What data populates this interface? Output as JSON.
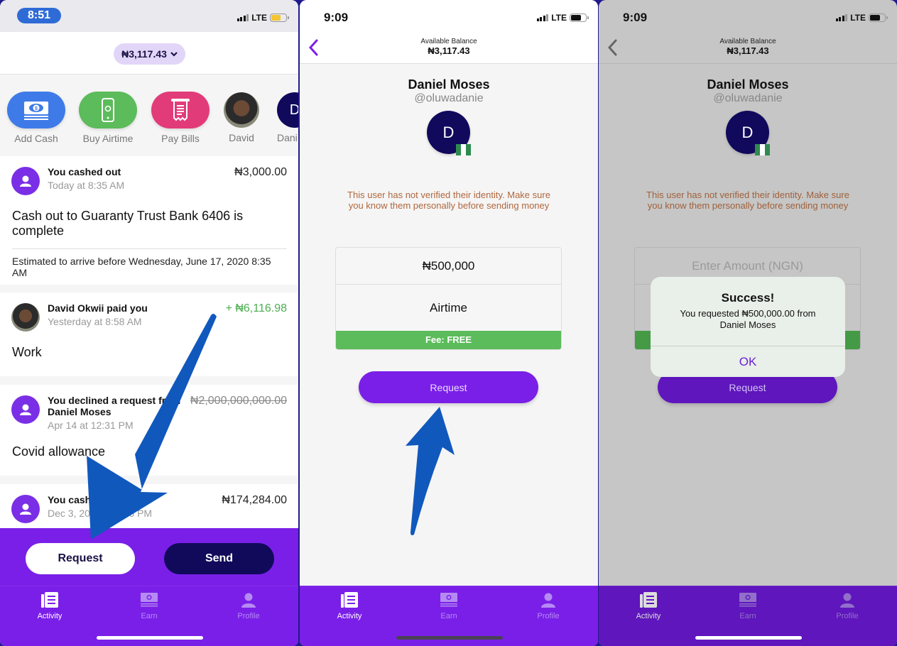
{
  "panel1": {
    "status": {
      "time": "8:51",
      "network": "LTE"
    },
    "balance": "₦3,117.43",
    "quick_actions": [
      {
        "label": "Add Cash",
        "icon": "cash-icon",
        "color": "#3f7be8"
      },
      {
        "label": "Buy Airtime",
        "icon": "phone-icon",
        "color": "#5cbb5a"
      },
      {
        "label": "Pay Bills",
        "icon": "receipt-icon",
        "color": "#e23b7a"
      },
      {
        "label": "David",
        "icon": "avatar"
      },
      {
        "label": "Dani",
        "initial": "D"
      }
    ],
    "feed": [
      {
        "title": "You cashed out",
        "time": "Today at 8:35 AM",
        "amount": "₦3,000.00",
        "memo": "Cash out to Guaranty Trust Bank 6406 is complete",
        "note": "Estimated to arrive before Wednesday, June 17, 2020 8:35 AM"
      },
      {
        "title": "David Okwii paid you",
        "time": "Yesterday at 8:58 AM",
        "amount": "+ ₦6,116.98",
        "memo": "Work"
      },
      {
        "title": "You declined a request from Daniel Moses",
        "time": "Apr 14 at 12:31 PM",
        "amount": "₦2,000,000,000.00",
        "memo": "Covid allowance"
      },
      {
        "title": "You cashed out",
        "time": "Dec 3, 2019 at 6:46 PM",
        "amount": "₦174,284.00"
      }
    ],
    "buttons": {
      "request": "Request",
      "send": "Send"
    }
  },
  "screen": {
    "time": "9:09",
    "network": "LTE",
    "balance_caption": "Available Balance",
    "balance": "₦3,117.43",
    "name": "Daniel Moses",
    "handle": "@oluwadanie",
    "initial": "D",
    "warning": "This user has not verified their identity. Make sure you know them personally before sending money",
    "amount": "₦500,000",
    "amount_placeholder": "Enter Amount (NGN)",
    "note": "Airtime",
    "fee": "Fee: FREE",
    "request_button": "Request"
  },
  "alert": {
    "title": "Success!",
    "message": "You requested ₦500,000.00 from Daniel Moses",
    "ok": "OK"
  },
  "tabs": [
    {
      "label": "Activity",
      "active": true
    },
    {
      "label": "Earn",
      "active": false
    },
    {
      "label": "Profile",
      "active": false
    }
  ],
  "colors": {
    "brand": "#7a1fe8",
    "navy": "#110a5a",
    "green": "#5cbb5a",
    "warning": "#b0673d",
    "credit": "#4caf50"
  }
}
